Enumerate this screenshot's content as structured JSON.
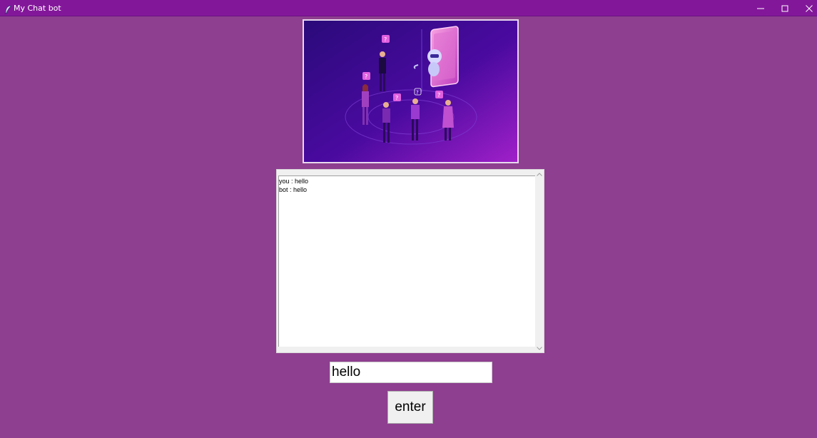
{
  "window": {
    "title": "My Chat bot",
    "icon": "feather-icon",
    "controls": [
      "minimize-icon",
      "maximize-icon",
      "close-icon"
    ]
  },
  "colors": {
    "background": "#8e3f8f",
    "titlebar": "#83179a"
  },
  "chat": {
    "messages": [
      {
        "text": "you : hello"
      },
      {
        "text": "bot : hello"
      }
    ]
  },
  "input": {
    "value": "hello"
  },
  "enter_button": {
    "label": "enter"
  }
}
